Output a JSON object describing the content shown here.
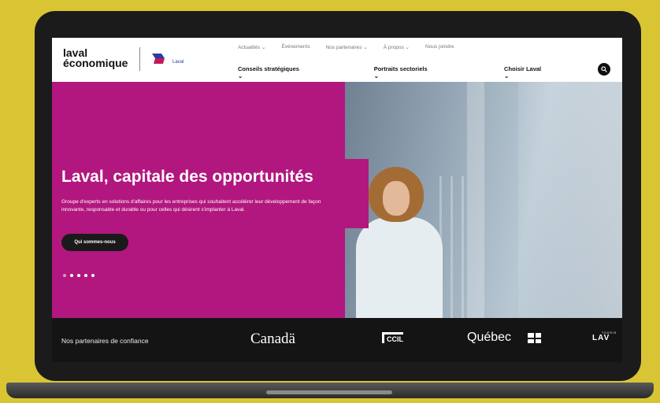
{
  "logo": {
    "line1": "laval",
    "line2": "économique",
    "laval_mark": "Laval"
  },
  "top_nav": [
    "Actualités",
    "Événements",
    "Nos partenaires",
    "À propos",
    "Nous joindre"
  ],
  "main_nav": [
    "Conseils stratégiques",
    "Portraits sectoriels",
    "Choisir Laval"
  ],
  "hero": {
    "title": "Laval, capitale des opportunités",
    "description": "Groupe d'experts en solutions d'affaires pour les entreprises qui souhaitent accélérer leur développement de façon innovante, responsable et durable ou pour celles qui désirent s'implanter à Laval.",
    "cta": "Qui sommes-nous",
    "slide_count": 5,
    "active_slide": 1
  },
  "partners": {
    "label": "Nos partenaires de confiance",
    "logos": [
      "Canadä",
      "CCIL",
      "Québec",
      "LAV"
    ],
    "tourisme_small": "TOURIS"
  },
  "colors": {
    "hero_magenta": "#b2177f",
    "background_yellow": "#d9c534",
    "dark": "#141414"
  },
  "icons": [
    "search-icon",
    "chevron-down-icon",
    "quebec-flag-icon"
  ]
}
